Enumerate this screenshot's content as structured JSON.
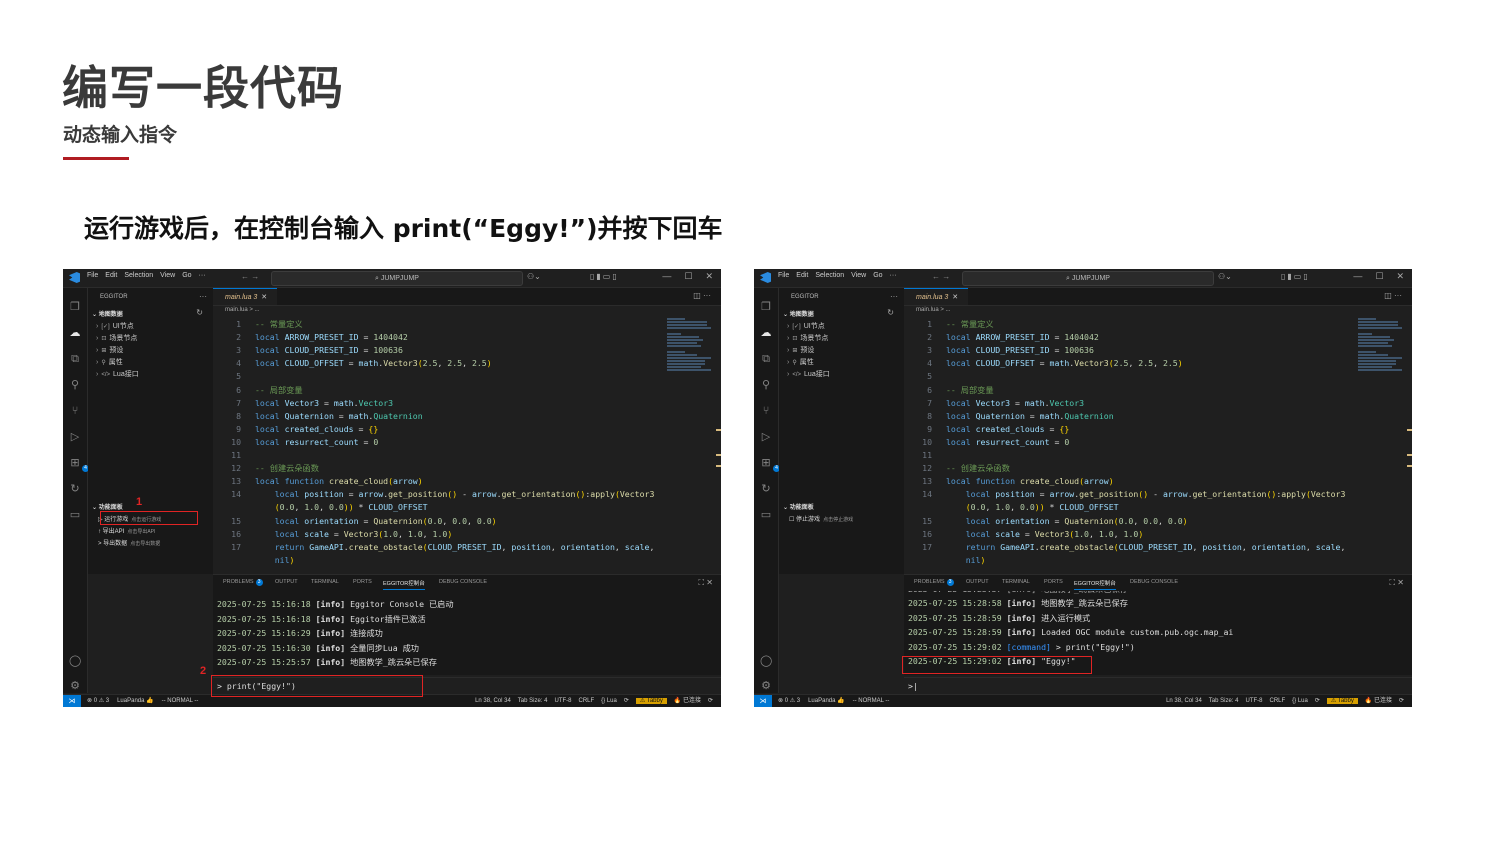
{
  "slide": {
    "title": "编写一段代码",
    "subtitle": "动态输入指令",
    "instruction": "运行游戏后，在控制台输入 print(“Eggy!”)并按下回车",
    "accent_color": "#b01c22"
  },
  "vscode": {
    "menus": [
      "File",
      "Edit",
      "Selection",
      "View",
      "Go",
      "···"
    ],
    "nav_arrows": "← →",
    "search_text": "⌕ JUMPJUMP",
    "copilot_icon": "copilot-icon",
    "window_controls": [
      "—",
      "☐",
      "✕"
    ],
    "sidebar": {
      "header": "EGGITOR",
      "section": "地图数据",
      "tree": [
        {
          "icon": "[✓]",
          "label": "UI节点",
          "has_chevron": true
        },
        {
          "icon": "⊡",
          "label": "场景节点",
          "has_chevron": true
        },
        {
          "icon": "⊞",
          "label": "预设",
          "has_chevron": true
        },
        {
          "icon": "⚲",
          "label": "属性",
          "has_chevron": true
        },
        {
          "icon": "</>",
          "label": "Lua接口",
          "has_chevron": true
        }
      ],
      "function_panel": "功能面板"
    },
    "tab": {
      "filename": "main.lua",
      "count": "3",
      "close": "✕"
    },
    "breadcrumb": "main.lua > ...",
    "code_lines": [
      {
        "n": "1",
        "tokens": [
          [
            "cm",
            "-- 常量定义"
          ]
        ]
      },
      {
        "n": "2",
        "tokens": [
          [
            "kw",
            "local "
          ],
          [
            "id",
            "ARROW_PRESET_ID"
          ],
          [
            "tx",
            " = "
          ],
          [
            "num",
            "1404042"
          ]
        ]
      },
      {
        "n": "3",
        "tokens": [
          [
            "kw",
            "local "
          ],
          [
            "id",
            "CLOUD_PRESET_ID"
          ],
          [
            "tx",
            " = "
          ],
          [
            "num",
            "100636"
          ]
        ]
      },
      {
        "n": "4",
        "tokens": [
          [
            "kw",
            "local "
          ],
          [
            "id",
            "CLOUD_OFFSET"
          ],
          [
            "tx",
            " = "
          ],
          [
            "id",
            "math"
          ],
          [
            "tx",
            "."
          ],
          [
            "fn",
            "Vector3"
          ],
          [
            "br",
            "("
          ],
          [
            "num",
            "2.5"
          ],
          [
            "tx",
            ", "
          ],
          [
            "num",
            "2.5"
          ],
          [
            "tx",
            ", "
          ],
          [
            "num",
            "2.5"
          ],
          [
            "br",
            ")"
          ]
        ]
      },
      {
        "n": "5",
        "tokens": []
      },
      {
        "n": "6",
        "tokens": [
          [
            "cm",
            "-- 局部变量"
          ]
        ]
      },
      {
        "n": "7",
        "tokens": [
          [
            "kw",
            "local "
          ],
          [
            "id",
            "Vector3"
          ],
          [
            "tx",
            " = "
          ],
          [
            "id",
            "math"
          ],
          [
            "tx",
            "."
          ],
          [
            "cl",
            "Vector3"
          ]
        ]
      },
      {
        "n": "8",
        "tokens": [
          [
            "kw",
            "local "
          ],
          [
            "id",
            "Quaternion"
          ],
          [
            "tx",
            " = "
          ],
          [
            "id",
            "math"
          ],
          [
            "tx",
            "."
          ],
          [
            "cl",
            "Quaternion"
          ]
        ]
      },
      {
        "n": "9",
        "tokens": [
          [
            "kw",
            "local "
          ],
          [
            "id",
            "created_clouds"
          ],
          [
            "tx",
            " = "
          ],
          [
            "br",
            "{}"
          ]
        ]
      },
      {
        "n": "10",
        "tokens": [
          [
            "kw",
            "local "
          ],
          [
            "id",
            "resurrect_count"
          ],
          [
            "tx",
            " = "
          ],
          [
            "num",
            "0"
          ]
        ]
      },
      {
        "n": "11",
        "tokens": []
      },
      {
        "n": "12",
        "tokens": [
          [
            "cm",
            "-- 创建云朵函数"
          ]
        ]
      },
      {
        "n": "13",
        "tokens": [
          [
            "kw",
            "local function "
          ],
          [
            "fn",
            "create_cloud"
          ],
          [
            "br",
            "("
          ],
          [
            "id",
            "arrow"
          ],
          [
            "br",
            ")"
          ]
        ]
      },
      {
        "n": "14",
        "tokens": [
          [
            "kw",
            "    local "
          ],
          [
            "id",
            "position"
          ],
          [
            "tx",
            " = "
          ],
          [
            "id",
            "arrow"
          ],
          [
            "tx",
            "."
          ],
          [
            "fn",
            "get_position"
          ],
          [
            "br",
            "()"
          ],
          [
            "tx",
            " - "
          ],
          [
            "id",
            "arrow"
          ],
          [
            "tx",
            "."
          ],
          [
            "fn",
            "get_orientation"
          ],
          [
            "br",
            "()"
          ],
          [
            "tx",
            ":"
          ],
          [
            "fn",
            "apply"
          ],
          [
            "br",
            "("
          ],
          [
            "fn",
            "Vector3"
          ]
        ]
      },
      {
        "n": "",
        "tokens": [
          [
            "br",
            "    ("
          ],
          [
            "num",
            "0.0"
          ],
          [
            "tx",
            ", "
          ],
          [
            "num",
            "1.0"
          ],
          [
            "tx",
            ", "
          ],
          [
            "num",
            "0.0"
          ],
          [
            "br",
            "))"
          ],
          [
            "tx",
            " * "
          ],
          [
            "id",
            "CLOUD_OFFSET"
          ]
        ]
      },
      {
        "n": "15",
        "tokens": [
          [
            "kw",
            "    local "
          ],
          [
            "id",
            "orientation"
          ],
          [
            "tx",
            " = "
          ],
          [
            "fn",
            "Quaternion"
          ],
          [
            "br",
            "("
          ],
          [
            "num",
            "0.0"
          ],
          [
            "tx",
            ", "
          ],
          [
            "num",
            "0.0"
          ],
          [
            "tx",
            ", "
          ],
          [
            "num",
            "0.0"
          ],
          [
            "br",
            ")"
          ]
        ]
      },
      {
        "n": "16",
        "tokens": [
          [
            "kw",
            "    local "
          ],
          [
            "id",
            "scale"
          ],
          [
            "tx",
            " = "
          ],
          [
            "fn",
            "Vector3"
          ],
          [
            "br",
            "("
          ],
          [
            "num",
            "1.0"
          ],
          [
            "tx",
            ", "
          ],
          [
            "num",
            "1.0"
          ],
          [
            "tx",
            ", "
          ],
          [
            "num",
            "1.0"
          ],
          [
            "br",
            ")"
          ]
        ]
      },
      {
        "n": "17",
        "tokens": [
          [
            "kw",
            "    return "
          ],
          [
            "id",
            "GameAPI"
          ],
          [
            "tx",
            "."
          ],
          [
            "fn",
            "create_obstacle"
          ],
          [
            "br",
            "("
          ],
          [
            "id",
            "CLOUD_PRESET_ID"
          ],
          [
            "tx",
            ", "
          ],
          [
            "id",
            "position"
          ],
          [
            "tx",
            ", "
          ],
          [
            "id",
            "orientation"
          ],
          [
            "tx",
            ", "
          ],
          [
            "id",
            "scale"
          ],
          [
            "tx",
            ","
          ]
        ]
      },
      {
        "n": "",
        "tokens": [
          [
            "kw",
            "    nil"
          ],
          [
            "br",
            ")"
          ]
        ]
      }
    ],
    "panel_tabs": [
      "PROBLEMS",
      "OUTPUT",
      "TERMINAL",
      "PORTS",
      "EGGITOR控制台",
      "DEBUG CONSOLE"
    ],
    "problems_badge": "3",
    "status_left": [
      "⊗ 0 ⚠ 3",
      "LuaPanda 👍",
      "-- NORMAL --"
    ],
    "status_right": [
      "Ln 38, Col 34",
      "Tab Size: 4",
      "UTF-8",
      "CRLF",
      "{} Lua",
      "⟳",
      "⚠ Tabby",
      "🔥 已连接",
      "⟳"
    ]
  },
  "left_shot": {
    "function_items": [
      {
        "icon": "▷",
        "label": "运行游戏",
        "hint": "点击运行游戏"
      },
      {
        "icon": "↑",
        "label": "导出API",
        "hint": "点击导出API"
      },
      {
        "icon": ">",
        "label": "导出数据",
        "hint": "点击导出数据"
      }
    ],
    "console": [
      {
        "ts": "2025-07-25 15:16:18",
        "tag": "[info]",
        "msg": " Eggitor Console 已启动"
      },
      {
        "ts": "2025-07-25 15:16:18",
        "tag": "[info]",
        "msg": " Eggitor插件已激活"
      },
      {
        "ts": "2025-07-25 15:16:29",
        "tag": "[info]",
        "msg": " 连接成功"
      },
      {
        "ts": "2025-07-25 15:16:30",
        "tag": "[info]",
        "msg": " 全量同步Lua 成功"
      },
      {
        "ts": "2025-07-25 15:25:57",
        "tag": "[info]",
        "msg": " 地图教学_跳云朵已保存"
      }
    ],
    "input": "> print(\"Eggy!\")",
    "marker1": "1",
    "marker2": "2"
  },
  "right_shot": {
    "function_items": [
      {
        "icon": "☐",
        "label": "停止游戏",
        "hint": "点击停止游戏"
      }
    ],
    "console_partial": "2025-07-25 15:25:57 [info] 地图教学_跳云朵已保存",
    "console": [
      {
        "ts": "2025-07-25 15:28:58",
        "tag": "[info]",
        "msg": " 地图教学_跳云朵已保存"
      },
      {
        "ts": "2025-07-25 15:28:59",
        "tag": "[info]",
        "msg": " 进入运行模式"
      },
      {
        "ts": "2025-07-25 15:28:59",
        "tag": "[info]",
        "msg": " Loaded OGC module custom.pub.ogc.map_ai"
      },
      {
        "ts": "2025-07-25 15:29:02",
        "tag": "[command]",
        "msg": " > print(\"Eggy!\")"
      },
      {
        "ts": "2025-07-25 15:29:02",
        "tag": "[info]",
        "msg": " \"Eggy!\""
      }
    ],
    "input": ">|"
  }
}
